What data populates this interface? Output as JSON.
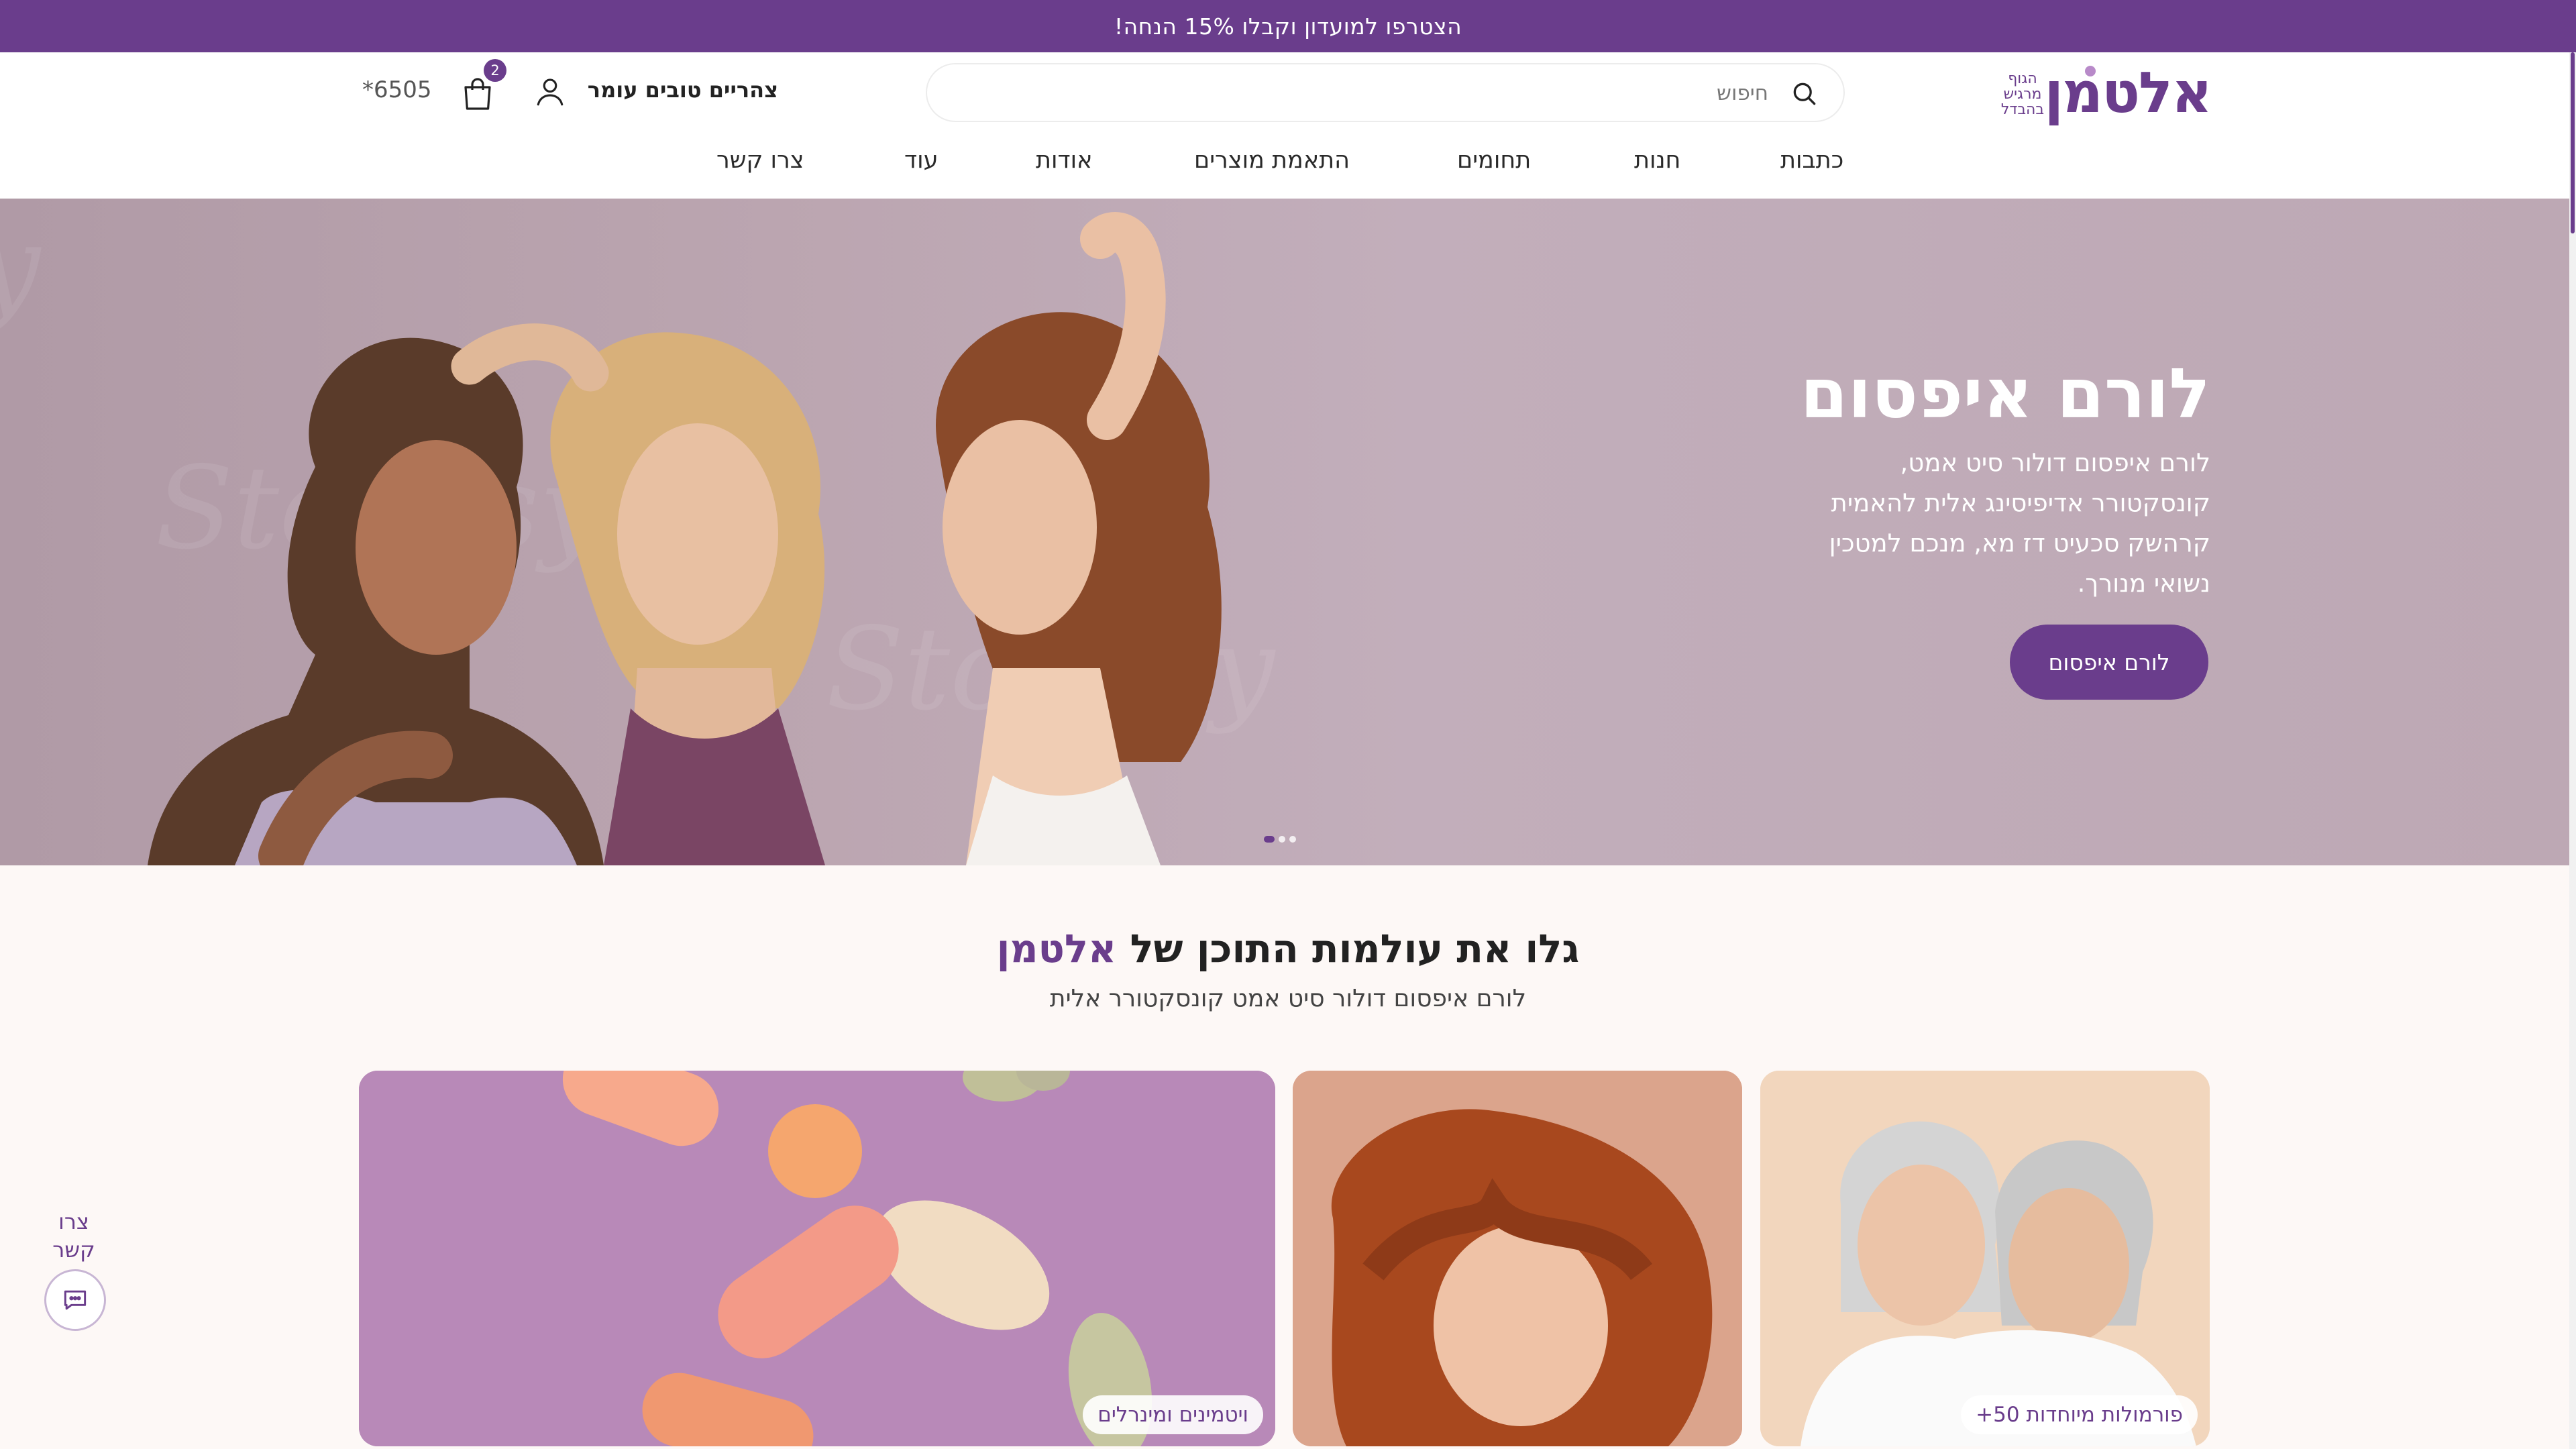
{
  "promo": {
    "text": "הצטרפו למועדון וקבלו 15% הנחה!"
  },
  "header": {
    "logo": {
      "word": "אלטמן",
      "tagline": "הגוף מרגיש בהבדל"
    },
    "search": {
      "placeholder": "חיפוש",
      "icon": "search-icon"
    },
    "greeting": "צהריים טובים עומר",
    "cart": {
      "count": "2",
      "icon": "shopping-bag-icon"
    },
    "user_icon": "user-icon",
    "phone": "*6505"
  },
  "nav": {
    "items": [
      {
        "label": "כתבות"
      },
      {
        "label": "חנות"
      },
      {
        "label": "תחומים"
      },
      {
        "label": "התאמת מוצרים"
      },
      {
        "label": "אודות"
      },
      {
        "label": "עוד"
      },
      {
        "label": "צרו קשר"
      }
    ]
  },
  "hero": {
    "title": "לורם איפסום",
    "text": "לורם איפסום דולור סיט אמט, קונסקטורר אדיפיסינג אלית להאמית קרהשק סכעיט דז מא, מנכם למטכין נשואי מנורך.",
    "button": "לורם איפסום",
    "watermark": "Stocksy"
  },
  "section": {
    "title_prefix": "גלו את עולמות התוכן של",
    "title_brand": "אלטמן",
    "subtitle": "לורם איפסום דולור סיט אמט קונסקטורר אלית"
  },
  "cards": [
    {
      "tag": "פורמולות מיוחדות 50+"
    },
    {
      "tag": ""
    },
    {
      "tag": "ויטמינים ומינרלים"
    }
  ],
  "floating_contact": {
    "label": "צרו קשר",
    "icon": "chat-icon"
  },
  "colors": {
    "brand": "#6a3d8c",
    "promo_bg": "#6a3d8c",
    "page_bg": "#fdf8f6"
  }
}
